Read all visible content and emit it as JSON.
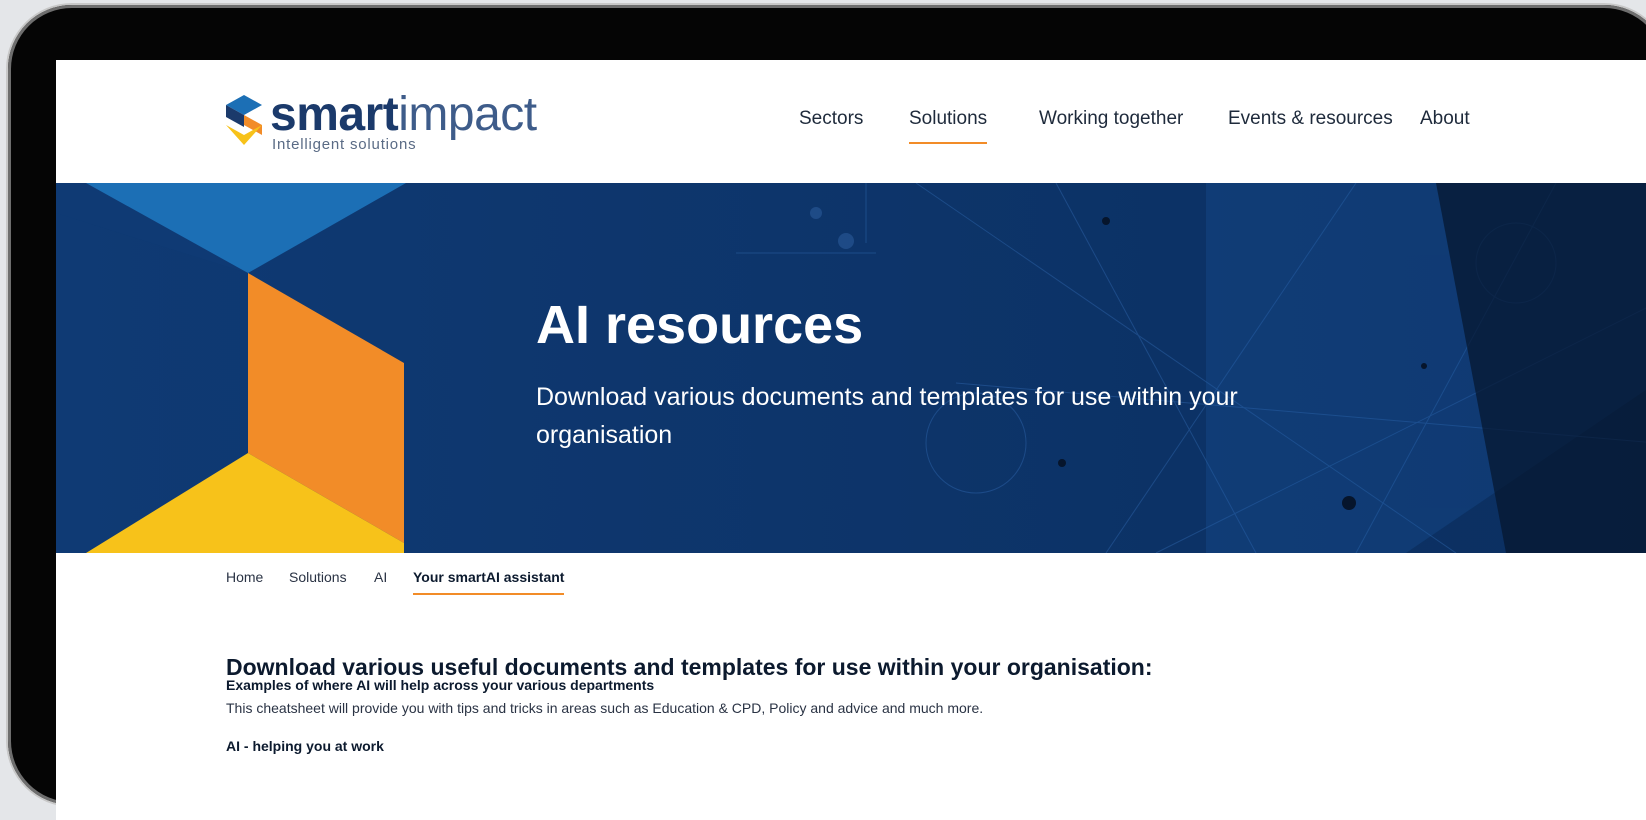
{
  "brand": {
    "name_bold": "smart",
    "name_light": "impact",
    "tagline": "Intelligent solutions",
    "colors": {
      "navy": "#0f3a74",
      "orange": "#f28c28",
      "yellow": "#f7c21a",
      "blue": "#1c6fb5"
    }
  },
  "nav": {
    "items": [
      {
        "label": "Sectors",
        "active": false
      },
      {
        "label": "Solutions",
        "active": true
      },
      {
        "label": "Working together",
        "active": false
      },
      {
        "label": "Events & resources",
        "active": false
      },
      {
        "label": "About",
        "active": false
      }
    ]
  },
  "hero": {
    "title": "AI resources",
    "subtitle": "Download various documents and templates for use within your organisation"
  },
  "breadcrumb": {
    "items": [
      "Home",
      "Solutions",
      "AI",
      "Your smartAI assistant"
    ]
  },
  "content": {
    "heading": "Download various useful documents and templates for use within your organisation:",
    "resources": [
      {
        "title": "Examples of where AI will help across your various departments",
        "description": "This cheatsheet will provide you with tips and tricks in areas such as Education & CPD, Policy and advice and much more."
      },
      {
        "title": "AI - helping you at work",
        "description": ""
      }
    ]
  }
}
